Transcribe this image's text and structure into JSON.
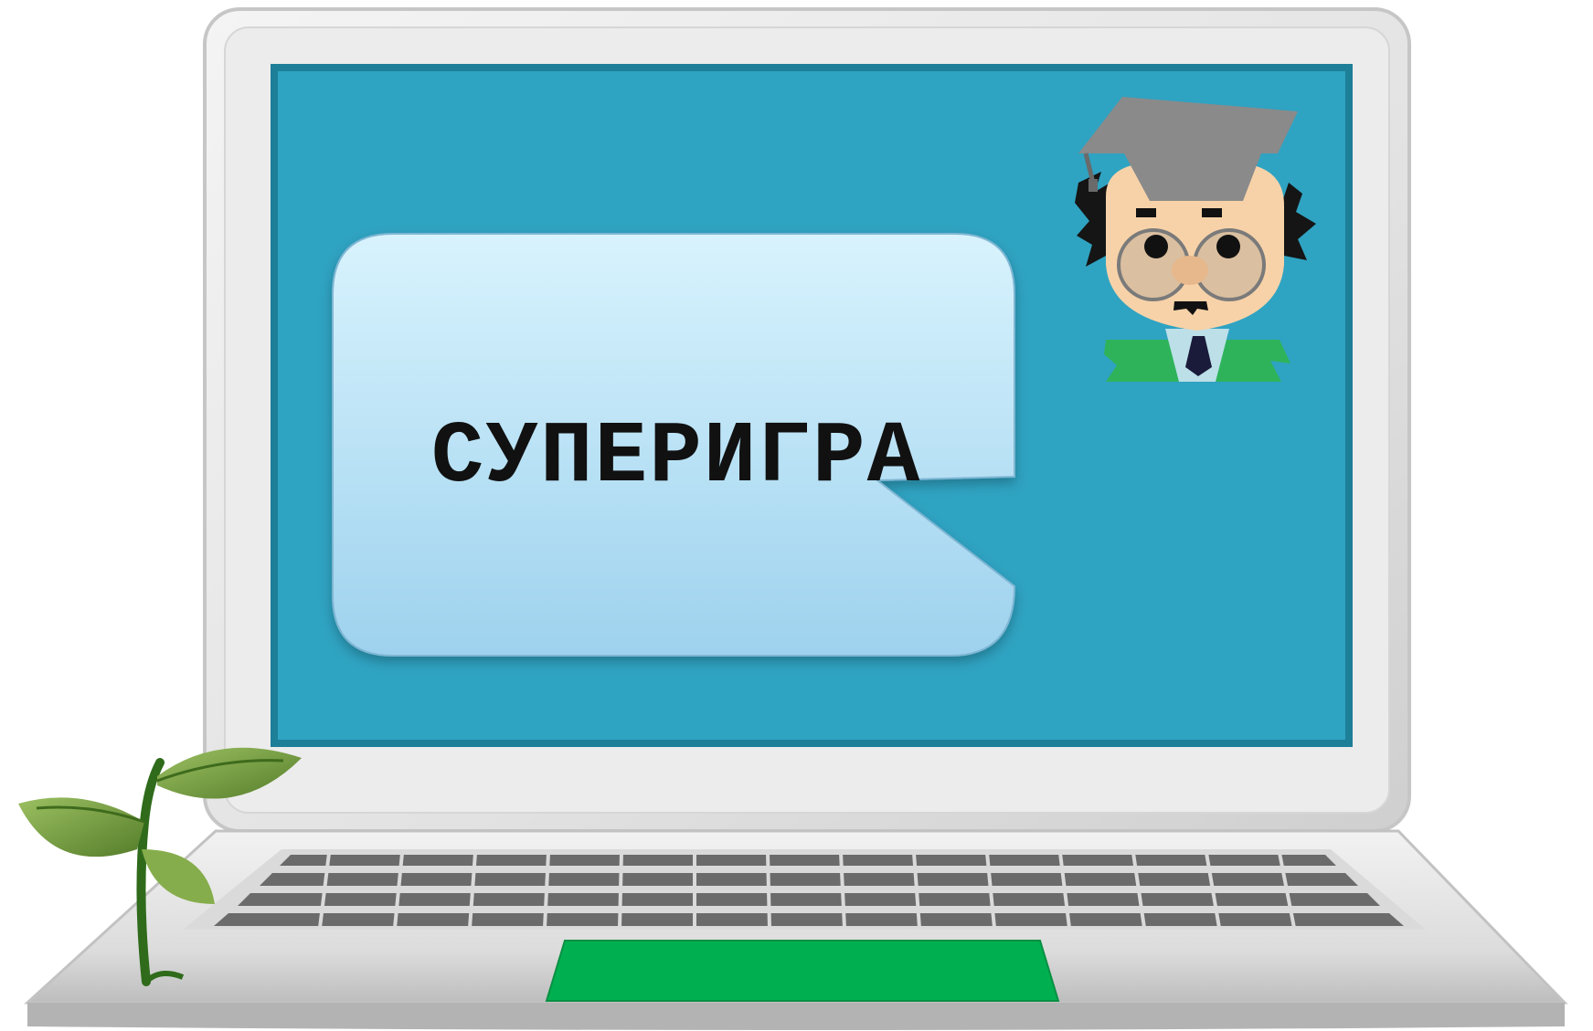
{
  "slide": {
    "title": "СУПЕРИГРА"
  },
  "colors": {
    "screen": "#2fa3c2",
    "screen_border": "#1d7f98",
    "bubble_top": "#d6f2fd",
    "bubble_bottom": "#9fd3ee",
    "trackpad": "#00b050",
    "laptop_body": "#e4e4e4",
    "key": "#6b6b6b",
    "leaf": "#6f9a3c",
    "hat": "#8a8a8a",
    "jacket": "#2eb35a"
  },
  "icons": {
    "mascot": "professor-icon",
    "plant": "sprout-icon",
    "laptop": "laptop-icon"
  }
}
